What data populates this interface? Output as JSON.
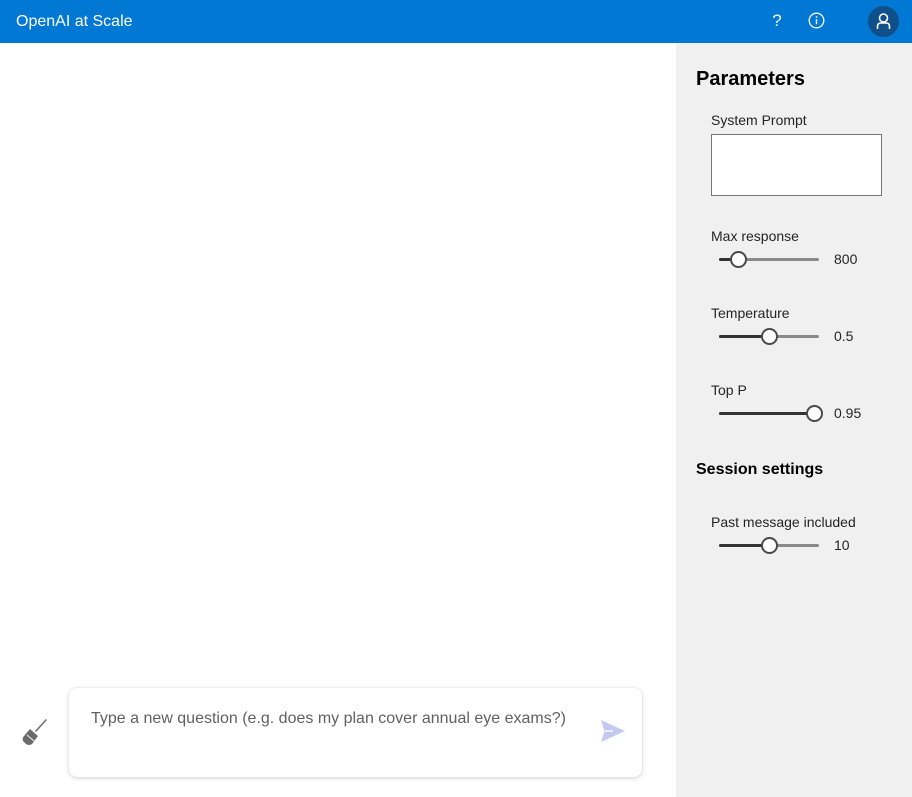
{
  "header": {
    "title": "OpenAI at Scale",
    "help_icon": "help-icon",
    "info_icon": "info-icon",
    "avatar_icon": "user-avatar-icon",
    "accent_color": "#0078d4"
  },
  "chat": {
    "input_placeholder": "Type a new question (e.g. does my plan cover annual eye exams?)",
    "input_value": "",
    "clear_icon": "broom-icon",
    "send_icon": "send-icon",
    "send_color": "#c5c8f0"
  },
  "parameters": {
    "title": "Parameters",
    "system_prompt": {
      "label": "System Prompt",
      "value": ""
    },
    "max_response": {
      "label": "Max response",
      "value": "800",
      "fraction": 0.19
    },
    "temperature": {
      "label": "Temperature",
      "value": "0.5",
      "fraction": 0.5
    },
    "top_p": {
      "label": "Top P",
      "value": "0.95",
      "fraction": 0.95
    }
  },
  "session": {
    "title": "Session settings",
    "past_messages": {
      "label": "Past message included",
      "value": "10",
      "fraction": 0.5
    }
  }
}
